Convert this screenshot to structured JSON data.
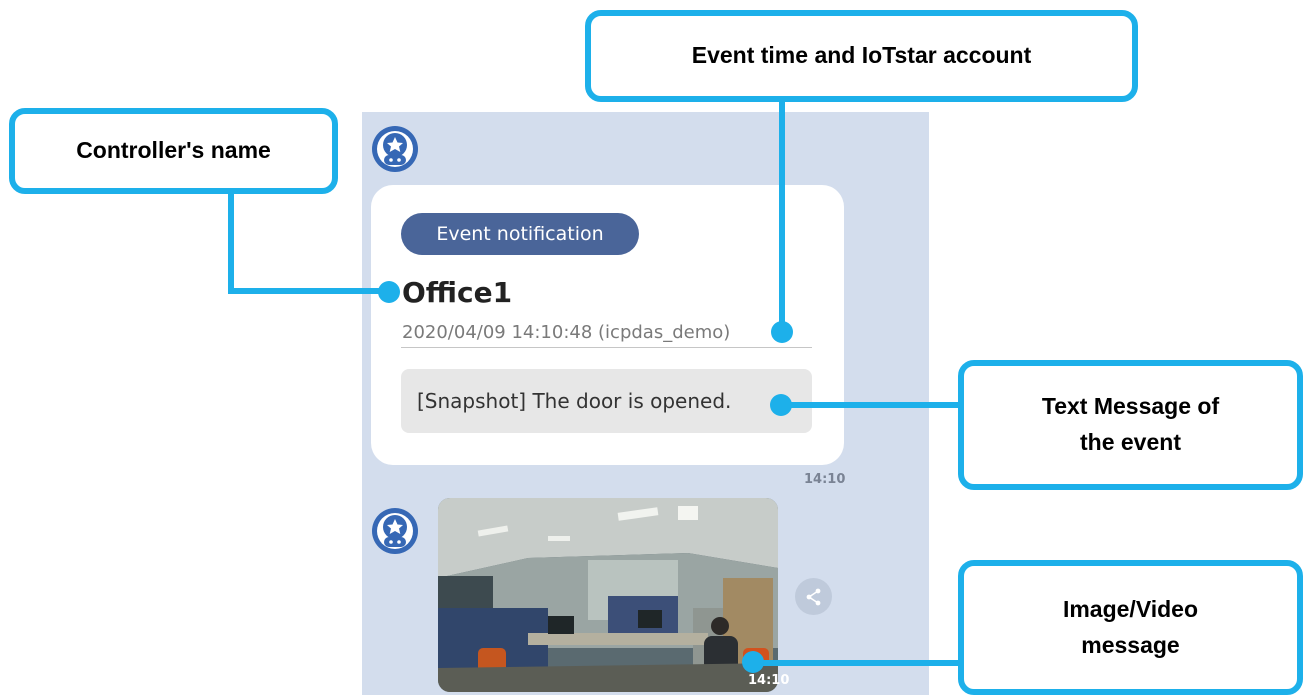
{
  "chat": {
    "event_badge": "Event notification",
    "controller_name": "Office1",
    "event_meta": "2020/04/09 14:10:48 (icpdas_demo)",
    "message_text": "[Snapshot] The door is opened.",
    "time_1": "14:10",
    "time_2": "14:10"
  },
  "callouts": {
    "event_time": "Event time and IoTstar account",
    "controller": "Controller's name",
    "text_line1": "Text Message of",
    "text_line2": "the event",
    "image_line1": "Image/Video",
    "image_line2": "message"
  },
  "colors": {
    "accent": "#1db0ea",
    "chat_background": "#d3dded",
    "badge": "#4a6599"
  },
  "icons": [
    "bot-avatar-icon",
    "share-icon"
  ]
}
